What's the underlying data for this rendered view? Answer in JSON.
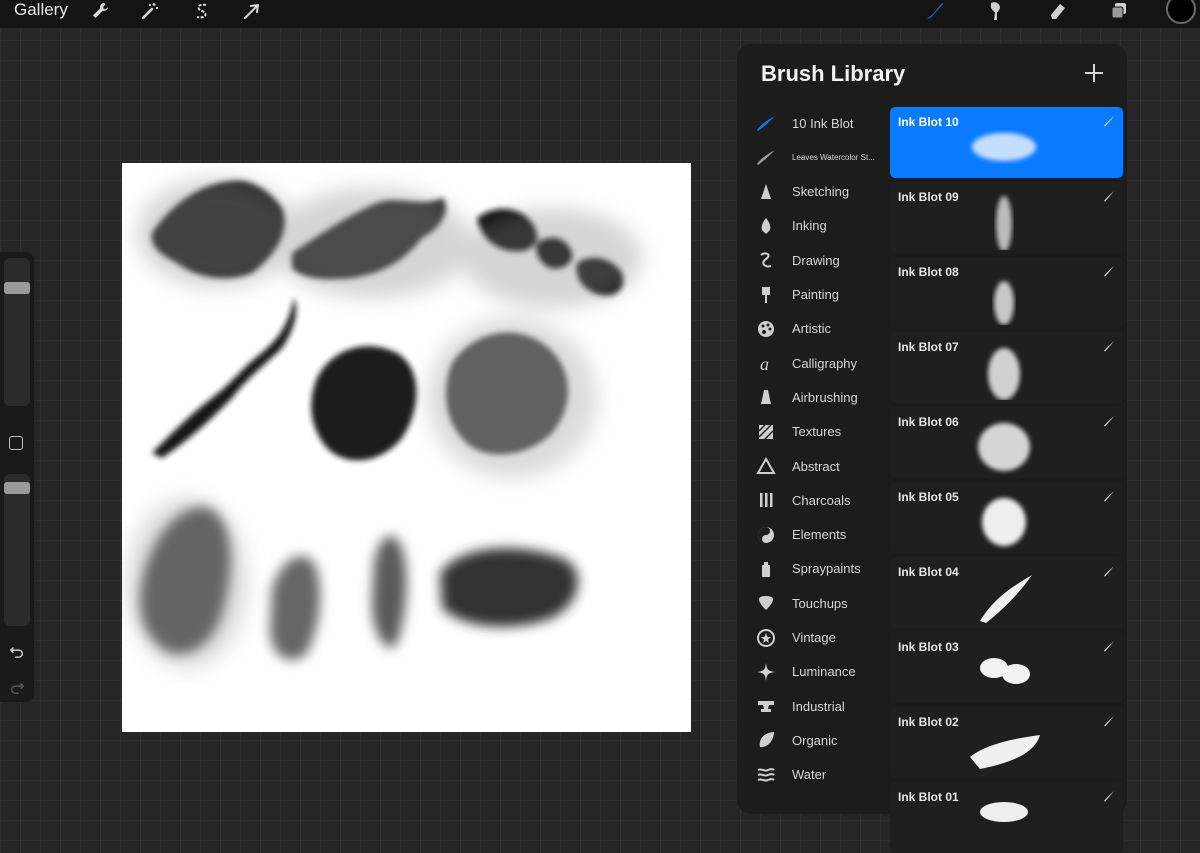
{
  "toolbar": {
    "gallery_label": "Gallery",
    "left_tools": [
      "wrench-icon",
      "magic-wand-icon",
      "selection-s-icon",
      "transform-arrow-icon"
    ],
    "right_tools": [
      "brush-icon",
      "smudge-icon",
      "eraser-icon",
      "layers-icon"
    ],
    "active_tool": "brush-icon",
    "accent_color": "#0a7bff",
    "current_color": "#000000"
  },
  "sidebar": {
    "brush_size_level": 0.82,
    "opacity_level": 0.94,
    "buttons": [
      "modify-square",
      "undo-icon",
      "redo-icon"
    ]
  },
  "brush_library": {
    "title": "Brush Library",
    "add_icon": "plus-icon",
    "categories": [
      {
        "label": "10 Ink Blot",
        "icon": "brush-stroke-icon",
        "selected": true
      },
      {
        "label": "Leaves Watercolor St...",
        "icon": "brush-stroke-icon"
      },
      {
        "label": "Sketching",
        "icon": "pencil-tip-icon"
      },
      {
        "label": "Inking",
        "icon": "pen-nib-icon"
      },
      {
        "label": "Drawing",
        "icon": "squiggle-icon"
      },
      {
        "label": "Painting",
        "icon": "paint-brush-icon"
      },
      {
        "label": "Artistic",
        "icon": "palette-icon"
      },
      {
        "label": "Calligraphy",
        "icon": "calligraphy-a-icon"
      },
      {
        "label": "Airbrushing",
        "icon": "airbrush-icon"
      },
      {
        "label": "Textures",
        "icon": "texture-icon"
      },
      {
        "label": "Abstract",
        "icon": "triangle-icon"
      },
      {
        "label": "Charcoals",
        "icon": "charcoal-icon"
      },
      {
        "label": "Elements",
        "icon": "yin-yang-icon"
      },
      {
        "label": "Spraypaints",
        "icon": "spray-can-icon"
      },
      {
        "label": "Touchups",
        "icon": "touchup-icon"
      },
      {
        "label": "Vintage",
        "icon": "star-badge-icon"
      },
      {
        "label": "Luminance",
        "icon": "sparkle-icon"
      },
      {
        "label": "Industrial",
        "icon": "anvil-icon"
      },
      {
        "label": "Organic",
        "icon": "leaf-icon"
      },
      {
        "label": "Water",
        "icon": "waves-icon"
      }
    ],
    "brushes": [
      {
        "label": "Ink Blot 10",
        "selected": true
      },
      {
        "label": "Ink Blot 09"
      },
      {
        "label": "Ink Blot 08"
      },
      {
        "label": "Ink Blot 07"
      },
      {
        "label": "Ink Blot 06"
      },
      {
        "label": "Ink Blot 05"
      },
      {
        "label": "Ink Blot 04"
      },
      {
        "label": "Ink Blot 03"
      },
      {
        "label": "Ink Blot 02"
      },
      {
        "label": "Ink Blot 01"
      }
    ]
  }
}
